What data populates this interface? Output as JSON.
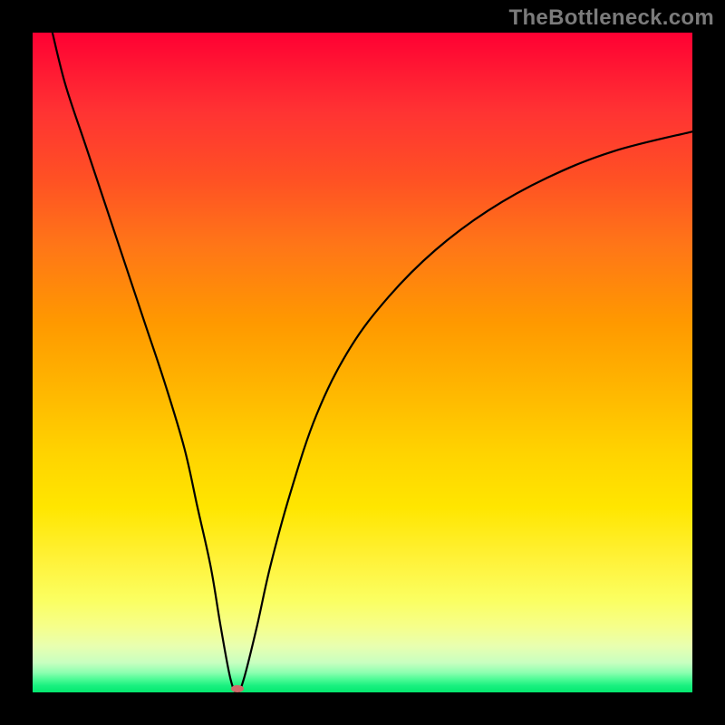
{
  "watermark": "TheBottleneck.com",
  "chart_data": {
    "type": "line",
    "title": "",
    "xlabel": "",
    "ylabel": "",
    "xlim": [
      0,
      100
    ],
    "ylim": [
      0,
      100
    ],
    "grid": false,
    "legend": false,
    "series": [
      {
        "name": "bottleneck-curve",
        "x": [
          3,
          5,
          8,
          11,
          14,
          17,
          20,
          23,
          25,
          27,
          28.5,
          30,
          31,
          32,
          34,
          36,
          39,
          43,
          48,
          54,
          61,
          69,
          78,
          88,
          100
        ],
        "values": [
          100,
          92,
          83,
          74,
          65,
          56,
          47,
          37,
          28,
          19,
          10,
          2,
          0,
          2,
          10,
          19,
          30,
          42,
          52,
          60,
          67,
          73,
          78,
          82,
          85
        ]
      }
    ],
    "annotations": [
      {
        "type": "marker",
        "x": 31,
        "y": 0.6,
        "color": "#d06a6a",
        "shape": "ellipse"
      }
    ],
    "background_gradient": {
      "top": "#ff0033",
      "bottom": "#04e86f",
      "type": "red-yellow-green"
    }
  }
}
